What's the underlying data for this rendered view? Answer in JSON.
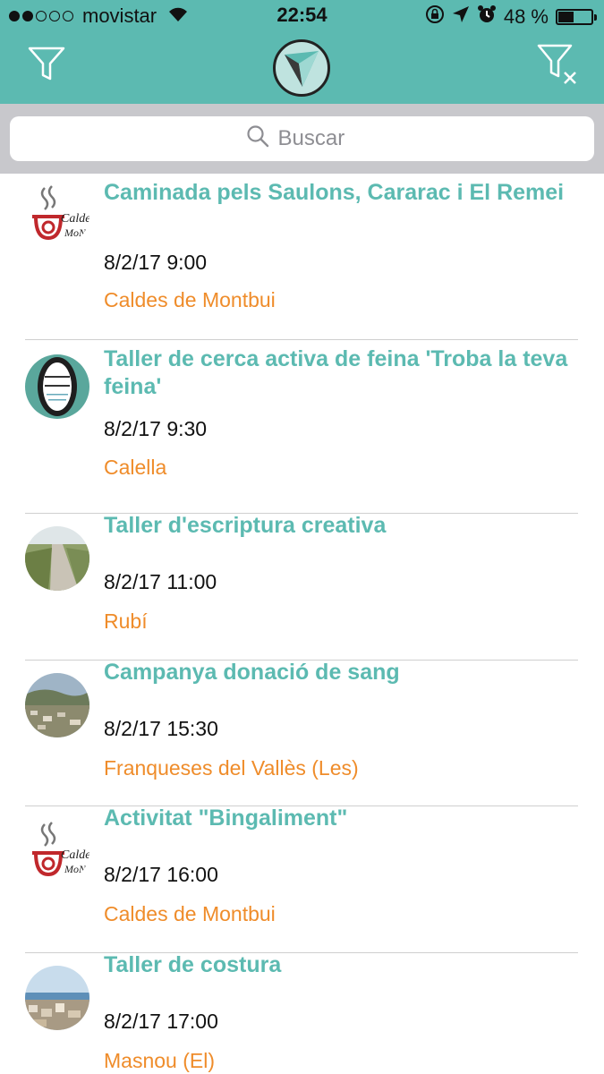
{
  "status": {
    "carrier": "movistar",
    "time": "22:54",
    "battery_text": "48 %",
    "battery_level": 0.48
  },
  "colors": {
    "header": "#5cbab1",
    "title": "#5cbab1",
    "place": "#ef8c2a"
  },
  "nav": {
    "left_icon": "filter-icon",
    "center_icon": "app-logo",
    "right_icon": "clear-filter-icon"
  },
  "search": {
    "placeholder": "Buscar",
    "value": ""
  },
  "events": [
    {
      "title": "Caminada pels Saulons, Cararac i El Remei",
      "date": "8/2/17 9:00",
      "place": "Caldes de Montbui",
      "avatar": "caldes-logo"
    },
    {
      "title": "Taller de cerca activa de feina 'Troba la teva feina'",
      "date": "8/2/17 9:30",
      "place": "Calella",
      "avatar": "troba-feina-logo"
    },
    {
      "title": "Taller d'escriptura creativa",
      "date": "8/2/17 11:00",
      "place": "Rubí",
      "avatar": "river-photo"
    },
    {
      "title": "Campanya donació de sang",
      "date": "8/2/17 15:30",
      "place": "Franqueses del Vallès (Les)",
      "avatar": "aerial-town-photo"
    },
    {
      "title": "Activitat \"Bingaliment\"",
      "date": "8/2/17 16:00",
      "place": "Caldes de Montbui",
      "avatar": "caldes-logo"
    },
    {
      "title": "Taller de costura",
      "date": "8/2/17 17:00",
      "place": "Masnou (El)",
      "avatar": "coastal-town-photo"
    }
  ]
}
